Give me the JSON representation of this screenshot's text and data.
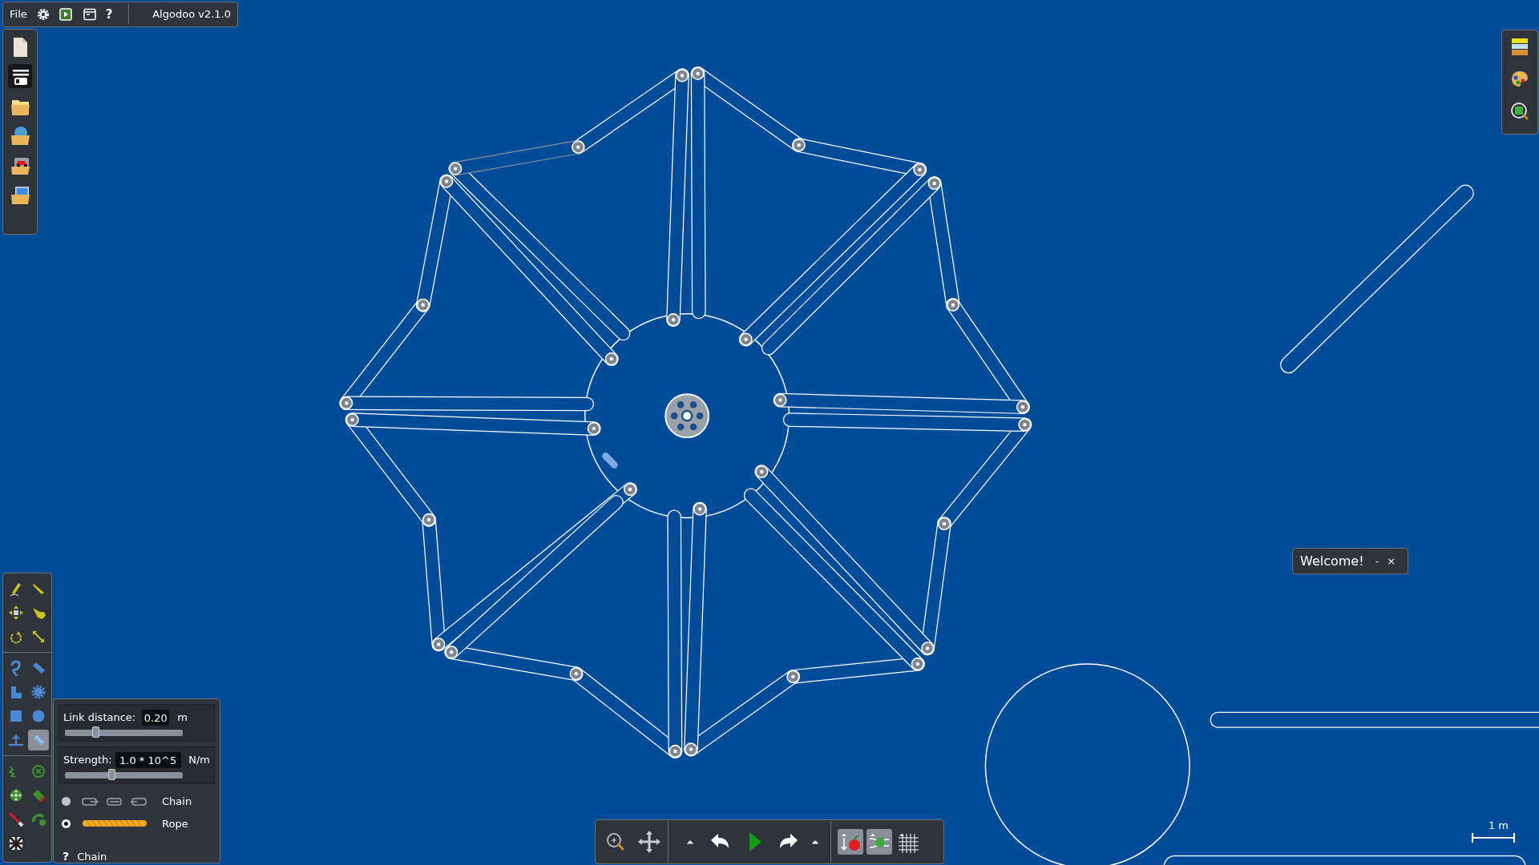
{
  "menu_bar": {
    "file_label": "File",
    "help_label": "?",
    "title": "Algodoo v2.1.0"
  },
  "file_toolbar": [
    {
      "selected": false
    },
    {
      "selected": true
    },
    {
      "selected": false
    },
    {
      "selected": false
    },
    {
      "selected": false
    },
    {
      "selected": false
    }
  ],
  "tool_palette": [
    {
      "selected": false
    },
    {
      "selected": false
    },
    {
      "selected": false
    },
    {
      "selected": false
    },
    {
      "selected": false
    },
    {
      "selected": false
    },
    {
      "selected": false
    },
    {
      "selected": false
    },
    {
      "selected": false
    },
    {
      "selected": false
    },
    {
      "selected": false
    },
    {
      "selected": false
    },
    {
      "selected": false
    },
    {
      "selected": true
    },
    {
      "selected": false
    },
    {
      "selected": false
    },
    {
      "selected": false
    },
    {
      "selected": false
    },
    {
      "selected": false
    },
    {
      "selected": false
    },
    {
      "selected": false
    }
  ],
  "options_panel": {
    "link_distance": {
      "label": "Link distance:",
      "value": "0.20",
      "unit": "m",
      "level": 0.26
    },
    "strength": {
      "label": "Strength:",
      "value": "1.0 * 10^5",
      "unit": "N/m",
      "level": 0.4
    },
    "types": [
      {
        "label": "Chain",
        "selected": false
      },
      {
        "label": "Rope",
        "selected": true
      }
    ],
    "help": {
      "icon": "?",
      "label": "Chain"
    }
  },
  "sim_toolbar": {
    "toggles": [
      {
        "on": true
      },
      {
        "on": true
      },
      {
        "on": false
      }
    ]
  },
  "welcome": {
    "title": "Welcome!",
    "minimize": "-",
    "close": "×"
  },
  "scale_bar": {
    "label": "1 m"
  }
}
